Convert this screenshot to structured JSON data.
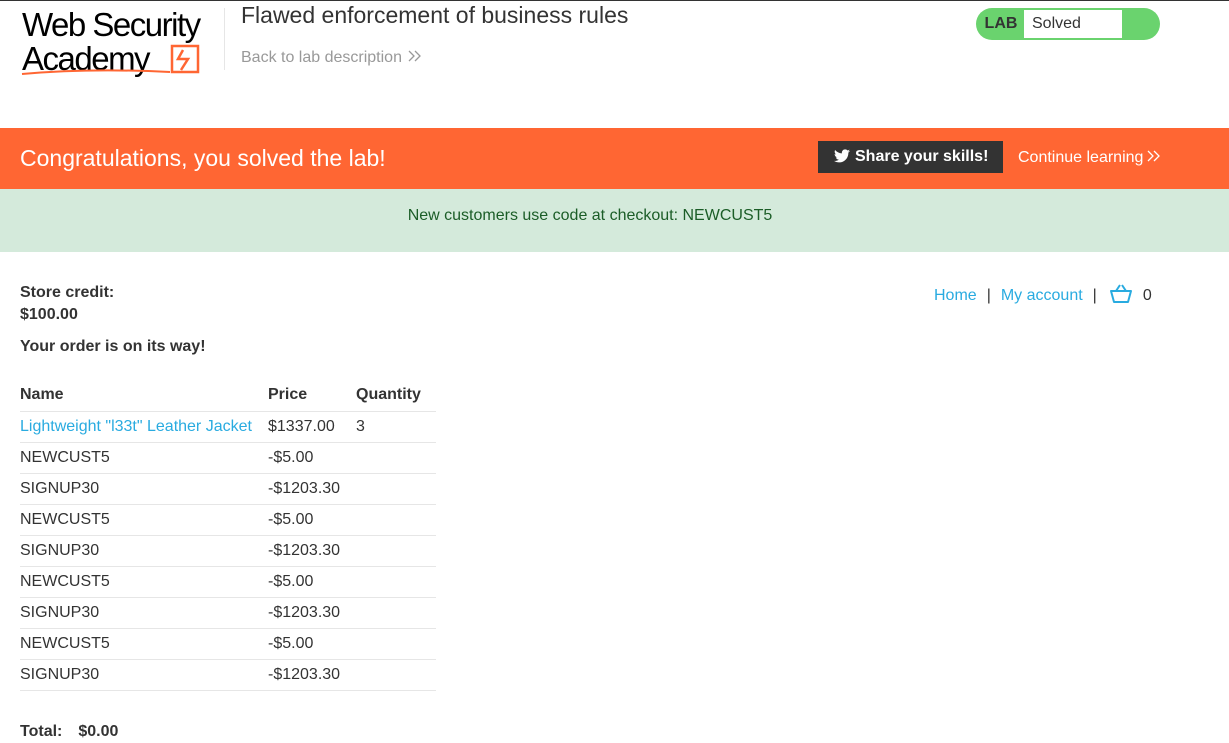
{
  "header": {
    "logo_line1": "Web Security",
    "logo_line2": "Academy",
    "lab_title": "Flawed enforcement of business rules",
    "back_link": "Back to lab description",
    "lab_tag": "LAB",
    "lab_status": "Solved"
  },
  "banner": {
    "message": "Congratulations, you solved the lab!",
    "share_label": "Share your skills!",
    "continue_label": "Continue learning"
  },
  "notice": {
    "text": "New customers use code at checkout: NEWCUST5"
  },
  "account": {
    "credit_label": "Store credit:",
    "credit_value": "$100.00",
    "order_message": "Your order is on its way!"
  },
  "nav": {
    "home": "Home",
    "separator1": "|",
    "my_account": "My account",
    "separator2": "|",
    "cart_count": "0"
  },
  "order_table": {
    "headers": {
      "name": "Name",
      "price": "Price",
      "quantity": "Quantity"
    },
    "rows": [
      {
        "name": "Lightweight \"l33t\" Leather Jacket",
        "price": "$1337.00",
        "quantity": "3"
      },
      {
        "name": "NEWCUST5",
        "price": "-$5.00",
        "quantity": ""
      },
      {
        "name": "SIGNUP30",
        "price": "-$1203.30",
        "quantity": ""
      },
      {
        "name": "NEWCUST5",
        "price": "-$5.00",
        "quantity": ""
      },
      {
        "name": "SIGNUP30",
        "price": "-$1203.30",
        "quantity": ""
      },
      {
        "name": "NEWCUST5",
        "price": "-$5.00",
        "quantity": ""
      },
      {
        "name": "SIGNUP30",
        "price": "-$1203.30",
        "quantity": ""
      },
      {
        "name": "NEWCUST5",
        "price": "-$5.00",
        "quantity": ""
      },
      {
        "name": "SIGNUP30",
        "price": "-$1203.30",
        "quantity": ""
      }
    ]
  },
  "total": {
    "label": "Total:",
    "value": "$0.00"
  },
  "colors": {
    "accent": "#ff6633",
    "link": "#29abe0",
    "solved_green": "#6ad36e",
    "notice_bg": "#d4eadb"
  }
}
